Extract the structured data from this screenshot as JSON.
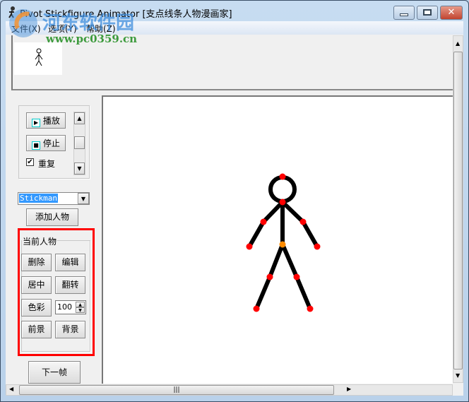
{
  "window": {
    "title": "Pivot Stickfigure Animator [支点线条人物漫画家]"
  },
  "menu": [
    "文件(X)",
    "选项(Y)",
    "帮助(Z)"
  ],
  "watermark": {
    "name": "河东软件园",
    "url": "www.pc0359.cn"
  },
  "playback": {
    "play": "播放",
    "stop": "停止",
    "repeat_label": "重复",
    "repeat_checked": true
  },
  "figure_select": {
    "value": "Stickman"
  },
  "add_figure": "添加人物",
  "current_figure": {
    "title": "当前人物",
    "delete": "删除",
    "edit": "编辑",
    "center": "居中",
    "flip": "翻转",
    "color": "色彩",
    "size": "100",
    "front": "前景",
    "back": "背景"
  },
  "next_frame": "下一帧",
  "colors": {
    "joint": "#ff0000",
    "hip_joint": "#ff8c00",
    "highlight": "#ff0000"
  }
}
